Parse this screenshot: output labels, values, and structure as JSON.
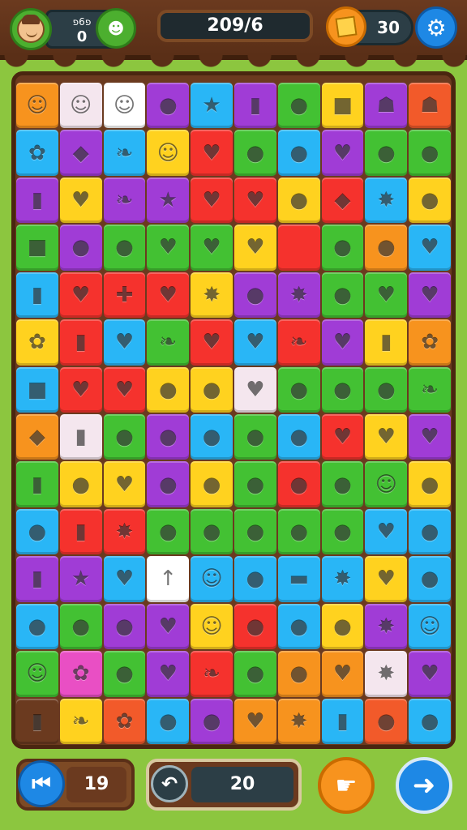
{
  "header": {
    "avatar_icon": "player-face-icon",
    "score_label": "פ6פ",
    "score_value": "0",
    "friend_button_icon": "face-icon",
    "level_text": "209/6",
    "coins_value": "30",
    "coin_icon": "gold-cube-icon",
    "settings_icon": "gear-icon"
  },
  "board": {
    "columns": 10,
    "rows": 14,
    "tiles": [
      {
        "c": "#f7931e",
        "s": "☺",
        "icon": "face-icon"
      },
      {
        "c": "#f4e6ee",
        "s": "☺",
        "icon": "face-icon"
      },
      {
        "c": "#ffffff",
        "s": "☺",
        "icon": "face-icon"
      },
      {
        "c": "#a03cd6",
        "s": "●",
        "icon": "plum-icon"
      },
      {
        "c": "#29b6f6",
        "s": "★",
        "icon": "star-icon"
      },
      {
        "c": "#a03cd6",
        "s": "▮",
        "icon": "can-icon"
      },
      {
        "c": "#43c133",
        "s": "●",
        "icon": "lime-icon"
      },
      {
        "c": "#ffd21f",
        "s": "■",
        "icon": "box-icon"
      },
      {
        "c": "#a03cd6",
        "s": "☗",
        "icon": "ghost-icon"
      },
      {
        "c": "#f25a2a",
        "s": "☗",
        "icon": "ghost-icon"
      },
      {
        "c": "#29b6f6",
        "s": "✿",
        "icon": "flower-icon"
      },
      {
        "c": "#a03cd6",
        "s": "◆",
        "icon": "diamond-icon"
      },
      {
        "c": "#29b6f6",
        "s": "❧",
        "icon": "leaf-icon"
      },
      {
        "c": "#ffd21f",
        "s": "☺",
        "icon": "face-icon"
      },
      {
        "c": "#f5322d",
        "s": "♥",
        "icon": "heart-icon"
      },
      {
        "c": "#43c133",
        "s": "●",
        "icon": "lime-icon"
      },
      {
        "c": "#29b6f6",
        "s": "●",
        "icon": "lime-icon"
      },
      {
        "c": "#a03cd6",
        "s": "♥",
        "icon": "pepper-icon"
      },
      {
        "c": "#43c133",
        "s": "●",
        "icon": "orange-icon"
      },
      {
        "c": "#43c133",
        "s": "●",
        "icon": "lemon-icon"
      },
      {
        "c": "#a03cd6",
        "s": "▮",
        "icon": "jar-icon"
      },
      {
        "c": "#ffd21f",
        "s": "♥",
        "icon": "heart-icon"
      },
      {
        "c": "#a03cd6",
        "s": "❧",
        "icon": "pea-icon"
      },
      {
        "c": "#a03cd6",
        "s": "★",
        "icon": "star-icon"
      },
      {
        "c": "#f5322d",
        "s": "♥",
        "icon": "heart-icon"
      },
      {
        "c": "#f5322d",
        "s": "♥",
        "icon": "heart-icon"
      },
      {
        "c": "#ffd21f",
        "s": "●",
        "icon": "lemon-icon"
      },
      {
        "c": "#f5322d",
        "s": "◆",
        "icon": "diamond-icon"
      },
      {
        "c": "#29b6f6",
        "s": "✸",
        "icon": "leaf-icon"
      },
      {
        "c": "#ffd21f",
        "s": "●",
        "icon": "orange-icon"
      },
      {
        "c": "#43c133",
        "s": "■",
        "icon": "box-icon"
      },
      {
        "c": "#a03cd6",
        "s": "●",
        "icon": "lemon-icon"
      },
      {
        "c": "#43c133",
        "s": "●",
        "icon": "lime-icon"
      },
      {
        "c": "#43c133",
        "s": "♥",
        "icon": "heart-icon"
      },
      {
        "c": "#43c133",
        "s": "♥",
        "icon": "heart-icon"
      },
      {
        "c": "#ffd21f",
        "s": "♥",
        "icon": "heart-icon"
      },
      {
        "c": "#f5322d",
        "s": "",
        "icon": "empty-tile"
      },
      {
        "c": "#43c133",
        "s": "●",
        "icon": "lime-icon"
      },
      {
        "c": "#f7931e",
        "s": "●",
        "icon": "apple-icon"
      },
      {
        "c": "#29b6f6",
        "s": "♥",
        "icon": "leaf-heart-icon"
      },
      {
        "c": "#29b6f6",
        "s": "▮",
        "icon": "can-icon"
      },
      {
        "c": "#f5322d",
        "s": "♥",
        "icon": "heart-icon"
      },
      {
        "c": "#f5322d",
        "s": "✚",
        "icon": "clover-icon"
      },
      {
        "c": "#f5322d",
        "s": "♥",
        "icon": "pepper-icon"
      },
      {
        "c": "#ffd21f",
        "s": "✸",
        "icon": "leaf-icon"
      },
      {
        "c": "#a03cd6",
        "s": "●",
        "icon": "lemon-icon"
      },
      {
        "c": "#a03cd6",
        "s": "✸",
        "icon": "leaf-icon"
      },
      {
        "c": "#43c133",
        "s": "●",
        "icon": "lime-icon"
      },
      {
        "c": "#43c133",
        "s": "♥",
        "icon": "heart-icon"
      },
      {
        "c": "#a03cd6",
        "s": "♥",
        "icon": "heart-icon"
      },
      {
        "c": "#ffd21f",
        "s": "✿",
        "icon": "flower-icon"
      },
      {
        "c": "#f5322d",
        "s": "▮",
        "icon": "can-icon"
      },
      {
        "c": "#29b6f6",
        "s": "♥",
        "icon": "heart-icon"
      },
      {
        "c": "#43c133",
        "s": "❧",
        "icon": "leaf-icon"
      },
      {
        "c": "#f5322d",
        "s": "♥",
        "icon": "heart-icon"
      },
      {
        "c": "#29b6f6",
        "s": "♥",
        "icon": "heart-icon"
      },
      {
        "c": "#f5322d",
        "s": "❧",
        "icon": "leaf-icon"
      },
      {
        "c": "#a03cd6",
        "s": "♥",
        "icon": "heart-icon"
      },
      {
        "c": "#ffd21f",
        "s": "▮",
        "icon": "jar-icon"
      },
      {
        "c": "#f7931e",
        "s": "✿",
        "icon": "flower-icon"
      },
      {
        "c": "#29b6f6",
        "s": "■",
        "icon": "box-icon"
      },
      {
        "c": "#f5322d",
        "s": "♥",
        "icon": "heart-icon"
      },
      {
        "c": "#f5322d",
        "s": "♥",
        "icon": "heart-icon"
      },
      {
        "c": "#ffd21f",
        "s": "●",
        "icon": "apple-icon"
      },
      {
        "c": "#ffd21f",
        "s": "●",
        "icon": "apple-icon"
      },
      {
        "c": "#f4e6ee",
        "s": "♥",
        "icon": "heart-icon"
      },
      {
        "c": "#43c133",
        "s": "●",
        "icon": "lime-icon"
      },
      {
        "c": "#43c133",
        "s": "●",
        "icon": "lime-icon"
      },
      {
        "c": "#43c133",
        "s": "●",
        "icon": "plum-icon"
      },
      {
        "c": "#43c133",
        "s": "❧",
        "icon": "pepper-icon"
      },
      {
        "c": "#f7931e",
        "s": "◆",
        "icon": "diamond-icon"
      },
      {
        "c": "#f4e6ee",
        "s": "▮",
        "icon": "jar-icon"
      },
      {
        "c": "#43c133",
        "s": "●",
        "icon": "lime-icon"
      },
      {
        "c": "#a03cd6",
        "s": "●",
        "icon": "plum-icon"
      },
      {
        "c": "#29b6f6",
        "s": "●",
        "icon": "apple-icon"
      },
      {
        "c": "#43c133",
        "s": "●",
        "icon": "melon-icon"
      },
      {
        "c": "#29b6f6",
        "s": "●",
        "icon": "lime-icon"
      },
      {
        "c": "#f5322d",
        "s": "♥",
        "icon": "pepper-icon"
      },
      {
        "c": "#ffd21f",
        "s": "♥",
        "icon": "pepper-icon"
      },
      {
        "c": "#a03cd6",
        "s": "♥",
        "icon": "heart-icon"
      },
      {
        "c": "#43c133",
        "s": "▮",
        "icon": "bottle-icon"
      },
      {
        "c": "#ffd21f",
        "s": "●",
        "icon": "apple-icon"
      },
      {
        "c": "#ffd21f",
        "s": "♥",
        "icon": "heart-icon"
      },
      {
        "c": "#a03cd6",
        "s": "●",
        "icon": "candy-icon"
      },
      {
        "c": "#ffd21f",
        "s": "●",
        "icon": "apple-icon"
      },
      {
        "c": "#43c133",
        "s": "●",
        "icon": "lime-icon"
      },
      {
        "c": "#f5322d",
        "s": "●",
        "icon": "orange-icon"
      },
      {
        "c": "#43c133",
        "s": "●",
        "icon": "apple-icon"
      },
      {
        "c": "#43c133",
        "s": "☺",
        "icon": "face-icon"
      },
      {
        "c": "#ffd21f",
        "s": "●",
        "icon": "orange-icon"
      },
      {
        "c": "#29b6f6",
        "s": "●",
        "icon": "orange-icon"
      },
      {
        "c": "#f5322d",
        "s": "▮",
        "icon": "can-icon"
      },
      {
        "c": "#f5322d",
        "s": "✸",
        "icon": "leaf-icon"
      },
      {
        "c": "#43c133",
        "s": "●",
        "icon": "melon-icon"
      },
      {
        "c": "#43c133",
        "s": "●",
        "icon": "lime-icon"
      },
      {
        "c": "#43c133",
        "s": "●",
        "icon": "apple-icon"
      },
      {
        "c": "#43c133",
        "s": "●",
        "icon": "lime-icon"
      },
      {
        "c": "#43c133",
        "s": "●",
        "icon": "melon-icon"
      },
      {
        "c": "#29b6f6",
        "s": "♥",
        "icon": "heart-icon"
      },
      {
        "c": "#29b6f6",
        "s": "●",
        "icon": "orange-icon"
      },
      {
        "c": "#a03cd6",
        "s": "▮",
        "icon": "jar-icon"
      },
      {
        "c": "#a03cd6",
        "s": "★",
        "icon": "star-icon"
      },
      {
        "c": "#29b6f6",
        "s": "♥",
        "icon": "heart-icon"
      },
      {
        "c": "#ffffff",
        "s": "↑",
        "icon": "arrow-icon"
      },
      {
        "c": "#29b6f6",
        "s": "☺",
        "icon": "face-icon"
      },
      {
        "c": "#29b6f6",
        "s": "●",
        "icon": "lime-icon"
      },
      {
        "c": "#29b6f6",
        "s": "▬",
        "icon": "stick-icon"
      },
      {
        "c": "#29b6f6",
        "s": "✸",
        "icon": "leaf-icon"
      },
      {
        "c": "#ffd21f",
        "s": "♥",
        "icon": "pepper-icon"
      },
      {
        "c": "#29b6f6",
        "s": "●",
        "icon": "apple-icon"
      },
      {
        "c": "#29b6f6",
        "s": "●",
        "icon": "apple-icon"
      },
      {
        "c": "#43c133",
        "s": "●",
        "icon": "apple-icon"
      },
      {
        "c": "#a03cd6",
        "s": "●",
        "icon": "lime-icon"
      },
      {
        "c": "#a03cd6",
        "s": "♥",
        "icon": "heart-icon"
      },
      {
        "c": "#ffd21f",
        "s": "☺",
        "icon": "face-icon"
      },
      {
        "c": "#f5322d",
        "s": "●",
        "icon": "apple-icon"
      },
      {
        "c": "#29b6f6",
        "s": "●",
        "icon": "lime-icon"
      },
      {
        "c": "#ffd21f",
        "s": "●",
        "icon": "apple-icon"
      },
      {
        "c": "#a03cd6",
        "s": "✸",
        "icon": "leaf-icon"
      },
      {
        "c": "#29b6f6",
        "s": "☺",
        "icon": "face-icon"
      },
      {
        "c": "#43c133",
        "s": "☺",
        "icon": "face-icon"
      },
      {
        "c": "#e94fc4",
        "s": "✿",
        "icon": "gear-flower-icon"
      },
      {
        "c": "#43c133",
        "s": "●",
        "icon": "lime-icon"
      },
      {
        "c": "#a03cd6",
        "s": "♥",
        "icon": "pepper-icon"
      },
      {
        "c": "#f5322d",
        "s": "❧",
        "icon": "leaf-icon"
      },
      {
        "c": "#43c133",
        "s": "●",
        "icon": "lime-icon"
      },
      {
        "c": "#f7931e",
        "s": "●",
        "icon": "plum-icon"
      },
      {
        "c": "#f7931e",
        "s": "♥",
        "icon": "heart-icon"
      },
      {
        "c": "#f4e6ee",
        "s": "✸",
        "icon": "leaf-icon"
      },
      {
        "c": "#a03cd6",
        "s": "♥",
        "icon": "heart-icon"
      },
      {
        "c": "#6b3a1f",
        "s": "▮",
        "icon": "jar-icon"
      },
      {
        "c": "#ffd21f",
        "s": "❧",
        "icon": "pea-icon"
      },
      {
        "c": "#f25a2a",
        "s": "✿",
        "icon": "flower-icon"
      },
      {
        "c": "#29b6f6",
        "s": "●",
        "icon": "apple-icon"
      },
      {
        "c": "#a03cd6",
        "s": "●",
        "icon": "apple-icon"
      },
      {
        "c": "#f7931e",
        "s": "♥",
        "icon": "heart-icon"
      },
      {
        "c": "#f7931e",
        "s": "✸",
        "icon": "leaf-icon"
      },
      {
        "c": "#29b6f6",
        "s": "▮",
        "icon": "can-icon"
      },
      {
        "c": "#f25a2a",
        "s": "●",
        "icon": "orange-icon"
      },
      {
        "c": "#29b6f6",
        "s": "●",
        "icon": "melon-icon"
      }
    ]
  },
  "footer": {
    "skip_icon": "skip-back-icon",
    "moves_value": "19",
    "undo_icon": "undo-icon",
    "undo_value": "20",
    "hint_icon": "hand-icon",
    "next_icon": "arrow-right-icon"
  }
}
